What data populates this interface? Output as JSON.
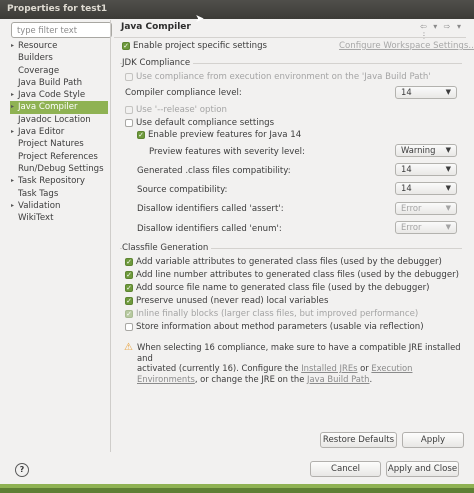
{
  "window": {
    "title": "Properties for test1"
  },
  "filter": {
    "placeholder": "type filter text"
  },
  "tree": [
    {
      "label": "Resource",
      "arrow": true
    },
    {
      "label": "Builders",
      "arrow": false
    },
    {
      "label": "Coverage",
      "arrow": false
    },
    {
      "label": "Java Build Path",
      "arrow": false
    },
    {
      "label": "Java Code Style",
      "arrow": true
    },
    {
      "label": "Java Compiler",
      "arrow": true,
      "selected": true
    },
    {
      "label": "Javadoc Location",
      "arrow": false
    },
    {
      "label": "Java Editor",
      "arrow": true
    },
    {
      "label": "Project Natures",
      "arrow": false
    },
    {
      "label": "Project References",
      "arrow": false
    },
    {
      "label": "Run/Debug Settings",
      "arrow": false
    },
    {
      "label": "Task Repository",
      "arrow": true
    },
    {
      "label": "Task Tags",
      "arrow": false
    },
    {
      "label": "Validation",
      "arrow": true
    },
    {
      "label": "WikiText",
      "arrow": false
    }
  ],
  "page": {
    "title": "Java Compiler",
    "nav_glyphs": "⇦ ▾ ⇨ ▾ ⋮",
    "enable_specific": "Enable project specific settings",
    "configure_link": "Configure Workspace Settings...",
    "jdk_group": "JDK Compliance",
    "use_compliance_env": "Use compliance from execution environment on the 'Java Build Path'",
    "compliance_level": "Compiler compliance level:",
    "compliance_value": "14",
    "use_release": "Use '--release' option",
    "use_default": "Use default compliance settings",
    "enable_preview": "Enable preview features for Java 14",
    "preview_severity": "Preview features with severity level:",
    "preview_severity_value": "Warning",
    "generated_class": "Generated .class files compatibility:",
    "generated_class_value": "14",
    "source_compat": "Source compatibility:",
    "source_compat_value": "14",
    "disallow_assert": "Disallow identifiers called 'assert':",
    "disallow_assert_value": "Error",
    "disallow_enum": "Disallow identifiers called 'enum':",
    "disallow_enum_value": "Error",
    "classfile_group": "Classfile Generation",
    "cf_vars": "Add variable attributes to generated class files (used by the debugger)",
    "cf_lines": "Add line number attributes to generated class files (used by the debugger)",
    "cf_source": "Add source file name to generated class file (used by the debugger)",
    "cf_preserve": "Preserve unused (never read) local variables",
    "cf_inline": "Inline finally blocks (larger class files, but improved performance)",
    "cf_params": "Store information about method parameters (usable via reflection)",
    "info_line1": "When selecting 16 compliance, make sure to have a compatible JRE installed and",
    "info_line2_a": "activated (currently 16). Configure the ",
    "info_link_jres": "Installed JREs",
    "info_line2_b": " or ",
    "info_link_env": "Execution",
    "info_link_env2": "Environments",
    "info_line3_a": ", or change the JRE on the ",
    "info_link_bp": "Java Build Path",
    "info_line3_b": "."
  },
  "buttons": {
    "restore": "Restore Defaults",
    "apply": "Apply",
    "cancel": "Cancel",
    "apply_close": "Apply and Close",
    "help": "?"
  }
}
